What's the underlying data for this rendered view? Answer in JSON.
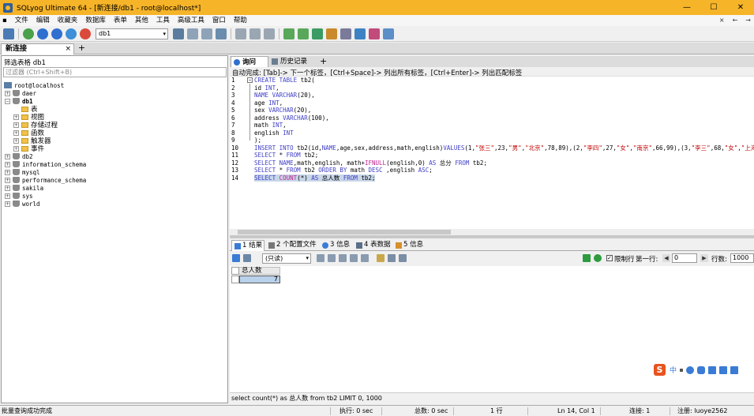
{
  "window": {
    "title": "SQLyog Ultimate 64 - [新连接/db1 - root@localhost*]"
  },
  "menu": [
    "文件",
    "编辑",
    "收藏夹",
    "数据库",
    "表单",
    "其他",
    "工具",
    "高级工具",
    "窗口",
    "帮助"
  ],
  "menu_right": [
    "×",
    "←",
    "→"
  ],
  "toolbar": {
    "database_select": "db1"
  },
  "connection_tab": {
    "label": "新连接",
    "close": "×",
    "add": "+"
  },
  "object_browser": {
    "filter_label": "筛选表格 db1",
    "filter_placeholder": "过滤器 (Ctrl+Shift+B)",
    "server": "root@localhost",
    "databases_top": [
      "daer"
    ],
    "current_db": "db1",
    "current_db_children": [
      "表",
      "视图",
      "存储过程",
      "函数",
      "触发器",
      "事件"
    ],
    "databases_bottom": [
      "db2",
      "information_schema",
      "mysql",
      "performance_schema",
      "sakila",
      "sys",
      "world"
    ]
  },
  "editor_tabs": {
    "query": "询问",
    "history": "历史记录",
    "add": "+"
  },
  "autocomplete_hint": "自动完成:  [Tab]-> 下一个标签，[Ctrl+Space]-> 列出所有标签，[Ctrl+Enter]-> 列出匹配标签",
  "code": {
    "line_numbers": [
      "1",
      "2",
      "3",
      "4",
      "5",
      "6",
      "7",
      "8",
      "9",
      "10",
      "11",
      "12",
      "13",
      "14"
    ],
    "l1": {
      "kw": "CREATE TABLE",
      "rest": " tb2("
    },
    "l2": {
      "a": "id ",
      "kw": "INT",
      "b": ","
    },
    "l3": {
      "kw1": "NAME",
      "a": " ",
      "kw2": "VARCHAR",
      "b": "(20),"
    },
    "l4": {
      "a": "age ",
      "kw": "INT",
      "b": ","
    },
    "l5": {
      "a": "sex ",
      "kw": "VARCHAR",
      "b": "(20),"
    },
    "l6": {
      "a": "address ",
      "kw": "VARCHAR",
      "b": "(100),"
    },
    "l7": {
      "a": "math ",
      "kw": "INT",
      "b": ","
    },
    "l8": {
      "a": "english ",
      "kw": "INT"
    },
    "l9": {
      "a": ");"
    },
    "l10": {
      "kw1": "INSERT INTO",
      "a": " tb2(id,",
      "kw2": "NAME",
      "b": ",age,sex,address,math,english)",
      "kw3": "VALUES",
      "c": "(1,",
      "s1": "\"张三\"",
      "d": ",23,",
      "s2": "\"男\"",
      "e": ",",
      "s3": "\"北京\"",
      "f": ",78,89),(2,",
      "s4": "\"李四\"",
      "g": ",27,",
      "s5": "\"女\"",
      "h": ",",
      "s6": "\"南京\"",
      "i": ",66,99),(3,",
      "s7": "\"李三\"",
      "j": ",68,",
      "s8": "\"女\"",
      "k": ",",
      "s9": "\"上海"
    },
    "l11": {
      "kw1": "SELECT",
      "a": " * ",
      "kw2": "FROM",
      "b": " tb2;"
    },
    "l12": {
      "kw1": "SELECT",
      "a": " ",
      "kw2": "NAME",
      "b": ",math,english, math+",
      "fn": "IFNULL",
      "c": "(english,0) ",
      "kw3": "AS",
      "d": " 总分 ",
      "kw4": "FROM",
      "e": " tb2;"
    },
    "l13": {
      "kw1": "SELECT",
      "a": " * ",
      "kw2": "FROM",
      "b": " tb2 ",
      "kw3": "ORDER BY",
      "c": " math ",
      "kw4": "DESC",
      "d": " ,english ",
      "kw5": "ASC",
      "e": ";"
    },
    "l14": {
      "kw1": "SELECT",
      "a": " ",
      "fn": "COUNT",
      "b": "(*) ",
      "kw2": "AS",
      "c": " 总人数 ",
      "kw3": "FROM",
      "d": " tb2;"
    }
  },
  "result_tabs": [
    "1 结果",
    "2 个配置文件",
    "3 信息",
    "4 表数据",
    "5 信息"
  ],
  "result_toolbar": {
    "mode": "(只读)",
    "limit_label": "限制行",
    "first_row_label": "第一行:",
    "first_row_value": "0",
    "rows_label": "行数:",
    "rows_value": "1000"
  },
  "grid": {
    "column": "总人数",
    "value": "7"
  },
  "ime": {
    "logo": "S",
    "lang": "中"
  },
  "sql_status": "select count(*) as 总人数 from tb2 LIMIT 0, 1000",
  "statusbar": {
    "left": "批量查询成功完成",
    "exec": "执行: 0 sec",
    "total": "总数: 0 sec",
    "rows": "1 行",
    "pos": "Ln 14, Col 1",
    "conn": "连接: 1",
    "reg": "注册: luoye2562"
  },
  "colors": {
    "titlebar": "#f6b428",
    "keyword": "#4040c8",
    "string": "#c00000",
    "function": "#c02090",
    "selection": "#b9d1ea"
  }
}
